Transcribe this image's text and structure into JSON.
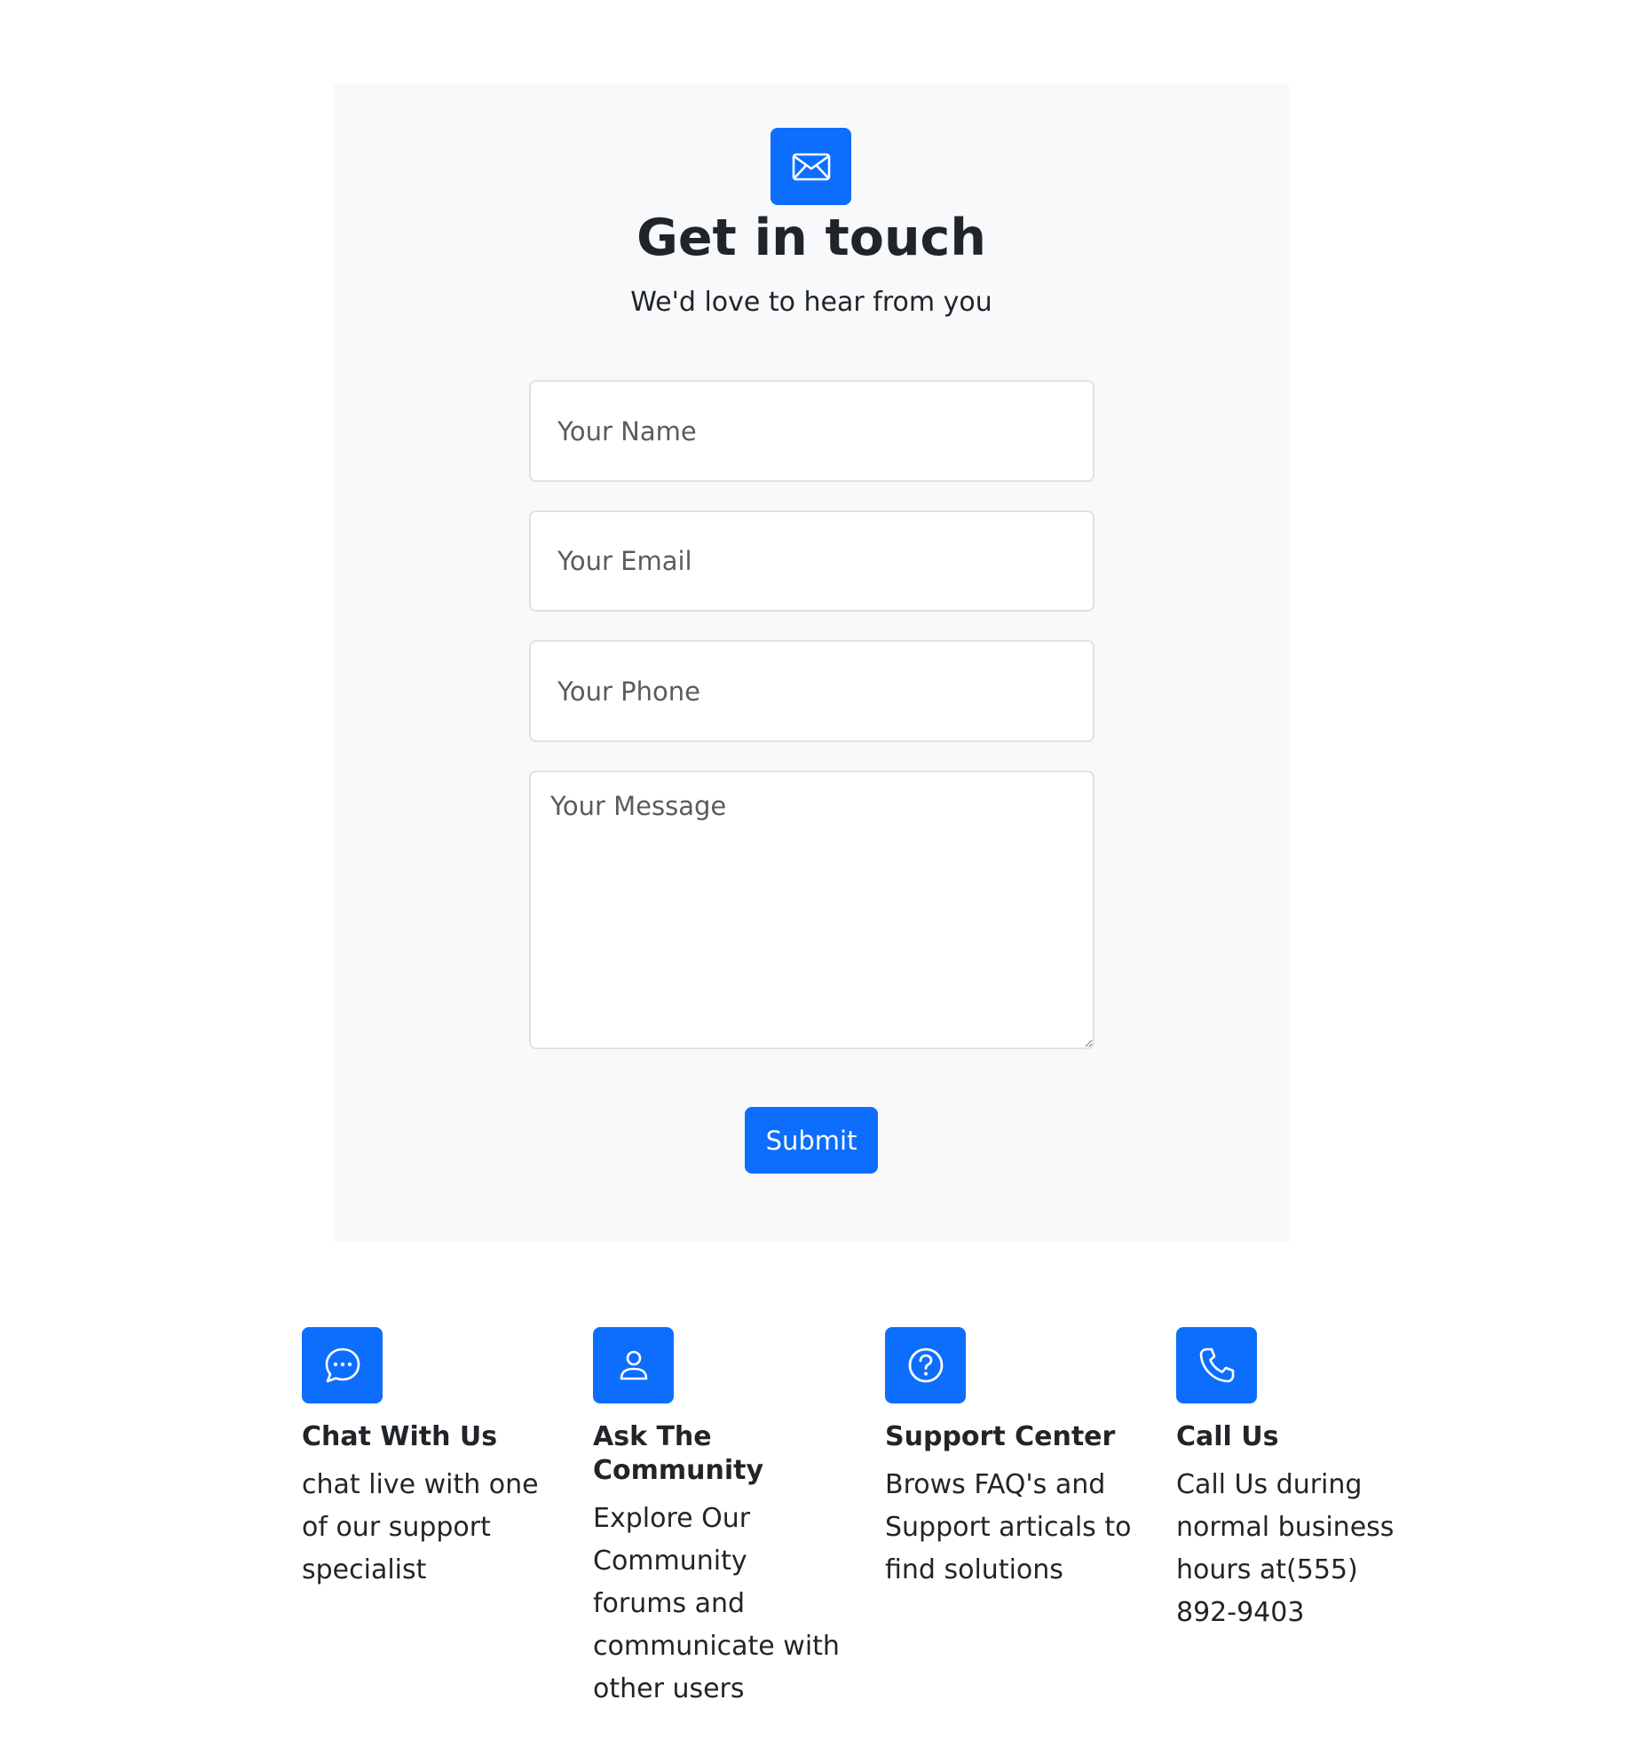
{
  "contact": {
    "icon": "envelope-icon",
    "title": "Get in touch",
    "subtitle": "We'd love to hear from you",
    "name_placeholder": "Your Name",
    "email_placeholder": "Your Email",
    "phone_placeholder": "Your Phone",
    "message_placeholder": "Your Message",
    "submit_label": "Submit"
  },
  "features": [
    {
      "icon": "chat-icon",
      "title": "Chat With Us",
      "text": "chat live with one of our support specialist"
    },
    {
      "icon": "person-icon",
      "title": "Ask The Community",
      "text": "Explore Our Community forums and communicate with other users"
    },
    {
      "icon": "question-circle-icon",
      "title": "Support Center",
      "text": "Brows FAQ's and Support articals to find solutions"
    },
    {
      "icon": "phone-icon",
      "title": "Call Us",
      "text": "Call Us during normal business hours at(555) 892-9403"
    }
  ],
  "colors": {
    "accent": "#0d6efd",
    "card_background": "#f8f9fa",
    "text": "#212529",
    "border": "#dee2e6"
  }
}
